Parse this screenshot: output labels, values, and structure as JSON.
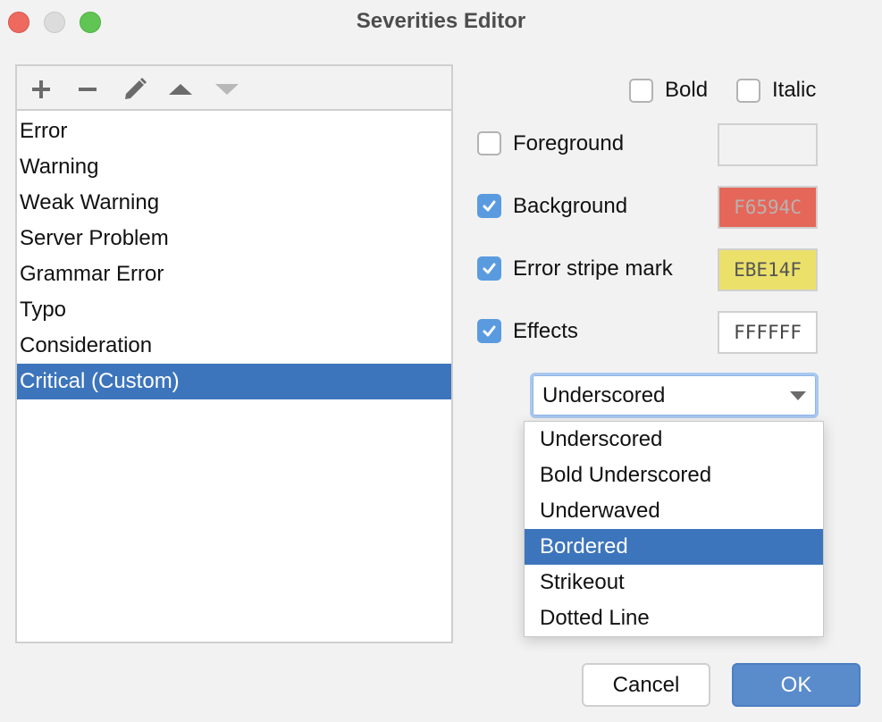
{
  "window": {
    "title": "Severities Editor"
  },
  "toolbar": {
    "buttons": [
      {
        "icon": "plus-icon",
        "label": "Add",
        "enabled": true
      },
      {
        "icon": "minus-icon",
        "label": "Remove",
        "enabled": true
      },
      {
        "icon": "pencil-icon",
        "label": "Edit",
        "enabled": true
      },
      {
        "icon": "arrow-up-icon",
        "label": "Move Up",
        "enabled": true
      },
      {
        "icon": "arrow-down-icon",
        "label": "Move Down",
        "enabled": false
      }
    ]
  },
  "severities": {
    "items": [
      {
        "label": "Error",
        "selected": false
      },
      {
        "label": "Warning",
        "selected": false
      },
      {
        "label": "Weak Warning",
        "selected": false
      },
      {
        "label": "Server Problem",
        "selected": false
      },
      {
        "label": "Grammar Error",
        "selected": false
      },
      {
        "label": "Typo",
        "selected": false
      },
      {
        "label": "Consideration",
        "selected": false
      },
      {
        "label": "Critical (Custom)",
        "selected": true
      }
    ]
  },
  "font_style": {
    "bold": {
      "label": "Bold",
      "checked": false
    },
    "italic": {
      "label": "Italic",
      "checked": false
    }
  },
  "attributes": {
    "foreground": {
      "label": "Foreground",
      "checked": false,
      "color": ""
    },
    "background": {
      "label": "Background",
      "checked": true,
      "color": "F6594C",
      "swatch_hex": "#e5675a"
    },
    "error_stripe": {
      "label": "Error stripe mark",
      "checked": true,
      "color": "EBE14F",
      "swatch_hex": "#ebe16a"
    },
    "effects": {
      "label": "Effects",
      "checked": true,
      "color": "FFFFFF",
      "swatch_hex": "#ffffff"
    }
  },
  "effect_type": {
    "selected": "Underscored",
    "options": [
      {
        "label": "Underscored",
        "highlighted": false
      },
      {
        "label": "Bold Underscored",
        "highlighted": false
      },
      {
        "label": "Underwaved",
        "highlighted": false
      },
      {
        "label": "Bordered",
        "highlighted": true
      },
      {
        "label": "Strikeout",
        "highlighted": false
      },
      {
        "label": "Dotted Line",
        "highlighted": false
      }
    ]
  },
  "buttons": {
    "cancel": "Cancel",
    "ok": "OK"
  },
  "colors": {
    "selection": "#3d75bc",
    "checkbox_checked": "#5a9be0",
    "ok_button": "#5a8ccc"
  }
}
